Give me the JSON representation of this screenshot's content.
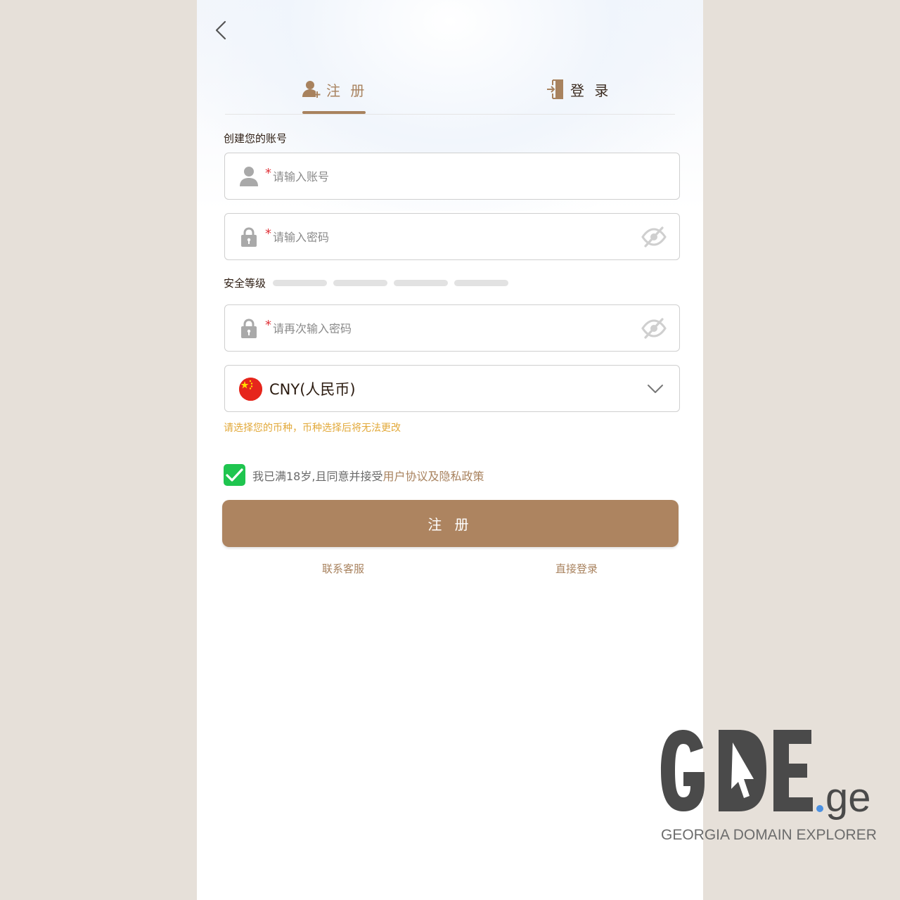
{
  "header": {
    "back_icon": "chevron-left-icon"
  },
  "tabs": {
    "register": {
      "label": "注 册",
      "icon": "user-add-icon"
    },
    "login": {
      "label": "登 录",
      "icon": "door-enter-icon"
    },
    "active": "register"
  },
  "form": {
    "section_title": "创建您的账号",
    "username": {
      "required_mark": "*",
      "placeholder": "请输入账号",
      "value": ""
    },
    "password": {
      "required_mark": "*",
      "placeholder": "请输入密码",
      "value": ""
    },
    "strength_label": "安全等级",
    "confirm_password": {
      "required_mark": "*",
      "placeholder": "请再次输入密码",
      "value": ""
    },
    "currency": {
      "selected": "CNY(人民币)"
    },
    "currency_note": "请选择您的币种，币种选择后将无法更改",
    "agree": {
      "checked": true,
      "text": "我已满18岁,且同意并接受",
      "link": "用户协议及隐私政策"
    },
    "submit_label": "注 册"
  },
  "bottom_links": {
    "left": "联系客服",
    "right": "直接登录"
  },
  "watermark": {
    "logo_text": "GDE.ge",
    "caption": "GEORGIA DOMAIN EXPLORER"
  },
  "colors": {
    "accent": "#ad8460",
    "checkbox": "#1fc54f",
    "note": "#e2a93a",
    "required": "#e0343a"
  }
}
